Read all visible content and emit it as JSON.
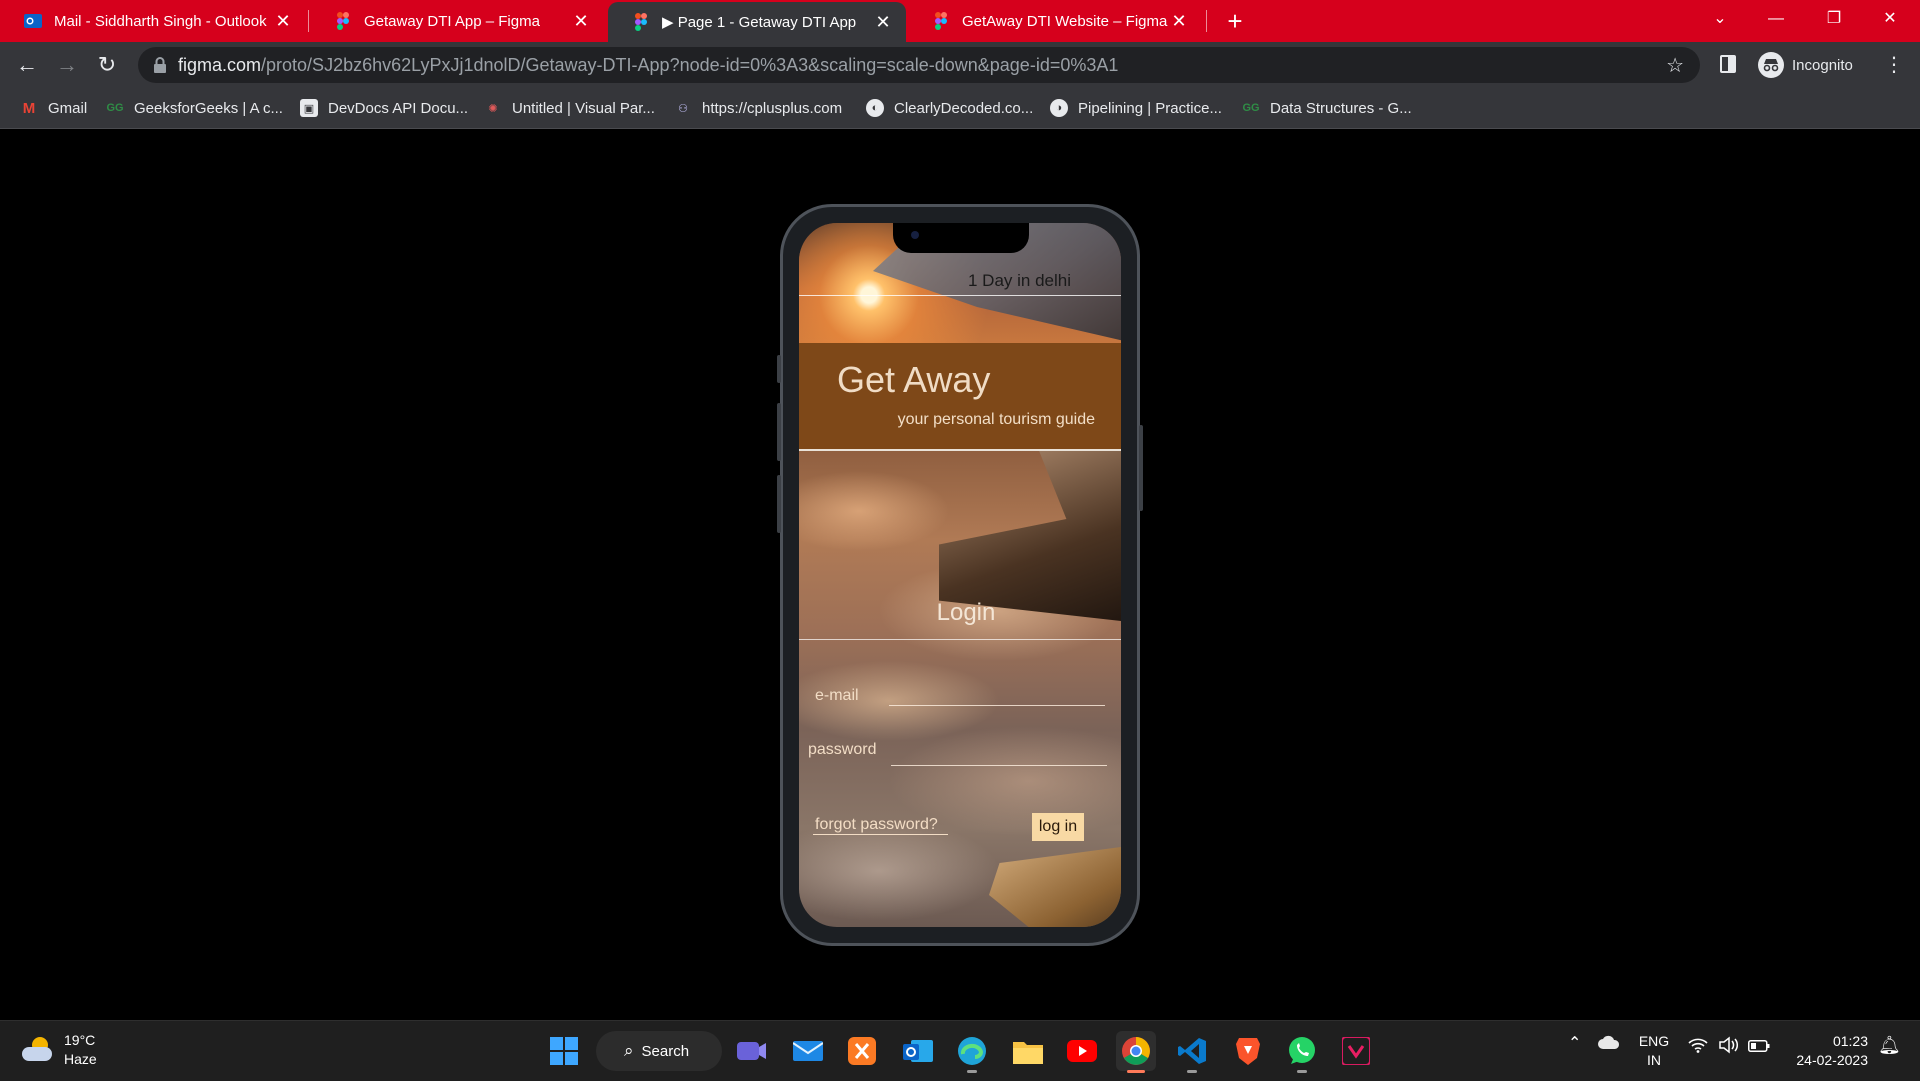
{
  "browser": {
    "tabs": [
      {
        "title": "Mail - Siddharth Singh - Outlook",
        "icon": "outlook-icon",
        "active": false
      },
      {
        "title": "Getaway DTI App – Figma",
        "icon": "figma-icon",
        "active": false
      },
      {
        "title": "▶ Page 1 - Getaway DTI App",
        "icon": "figma-icon",
        "active": true
      },
      {
        "title": "GetAway DTI Website – Figma",
        "icon": "figma-icon",
        "active": false
      }
    ],
    "url_host": "figma.com",
    "url_path": "/proto/SJ2bz6hv62LyPxJj1dnolD/Getaway-DTI-App?node-id=0%3A3&scaling=scale-down&page-id=0%3A1",
    "profile_label": "Incognito",
    "bookmarks": [
      {
        "label": "Gmail",
        "icon": "gmail-icon"
      },
      {
        "label": "GeeksforGeeks | A c...",
        "icon": "geeksforgeeks-icon"
      },
      {
        "label": "DevDocs API Docu...",
        "icon": "devdocs-icon"
      },
      {
        "label": "Untitled | Visual Par...",
        "icon": "visual-paradigm-icon"
      },
      {
        "label": "https://cplusplus.com",
        "icon": "cplusplus-icon"
      },
      {
        "label": "ClearlyDecoded.co...",
        "icon": "clearlydecoded-icon"
      },
      {
        "label": "Pipelining | Practice...",
        "icon": "practice-icon"
      },
      {
        "label": "Data Structures - G...",
        "icon": "geeksforgeeks-icon"
      }
    ]
  },
  "app": {
    "top_label": "1 Day in delhi",
    "brand_name": "Get Away",
    "brand_tagline": "your personal tourism guide",
    "login_title": "Login",
    "email_label": "e-mail",
    "password_label": "password",
    "forgot_label": "forgot password?",
    "login_button": "log in",
    "colors": {
      "brand_band": "#7e4818",
      "login_button_bg": "#f8d9a4",
      "chrome_tab_strip": "#d6001c"
    }
  },
  "taskbar": {
    "weather_temp": "19°C",
    "weather_desc": "Haze",
    "search_label": "Search",
    "lang_top": "ENG",
    "lang_bottom": "IN",
    "time": "01:23",
    "date": "24-02-2023",
    "apps": [
      "start-icon",
      "teams-icon",
      "mail-icon",
      "xampp-icon",
      "outlook-icon",
      "edge-icon",
      "file-explorer-icon",
      "youtube-icon",
      "chrome-icon",
      "vscode-icon",
      "brave-icon",
      "whatsapp-icon",
      "vectr-icon"
    ]
  }
}
